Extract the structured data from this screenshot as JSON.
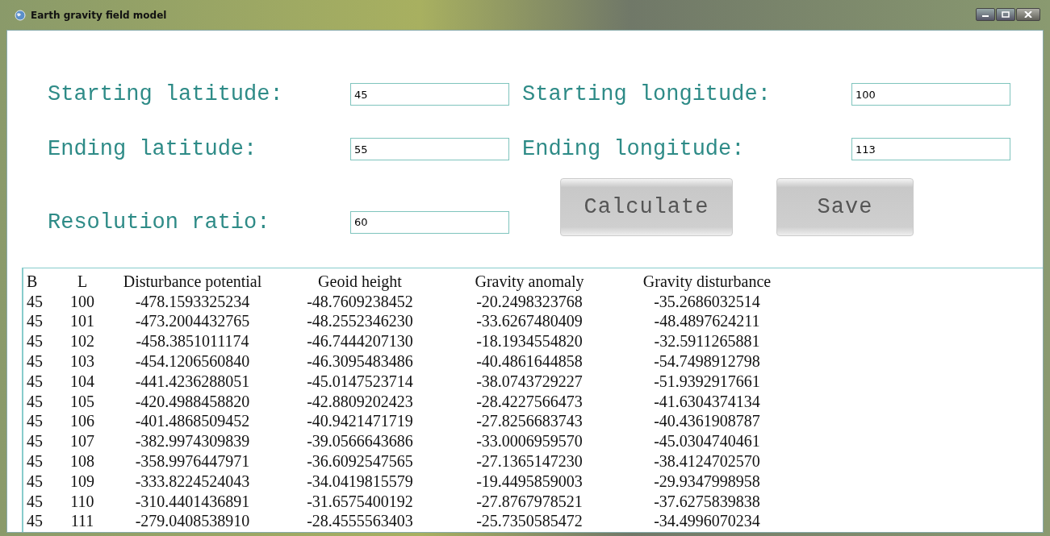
{
  "window": {
    "title": "Earth gravity field model"
  },
  "fields": [
    {
      "label": "Starting latitude:",
      "value": "45"
    },
    {
      "label": "Starting longitude:",
      "value": "100"
    },
    {
      "label": "Ending latitude:",
      "value": "55"
    },
    {
      "label": "Ending longitude:",
      "value": "113"
    },
    {
      "label": "Resolution ratio:",
      "value": "60"
    }
  ],
  "buttons": [
    "Calculate",
    "Save"
  ],
  "table": {
    "columns": [
      "B",
      "L",
      "Disturbance potential",
      "Geoid height",
      "Gravity anomaly",
      "Gravity disturbance"
    ],
    "rows": [
      [
        "45",
        "100",
        "-478.1593325234",
        "-48.7609238452",
        "-20.2498323768",
        "-35.2686032514"
      ],
      [
        "45",
        "101",
        "-473.2004432765",
        "-48.2552346230",
        "-33.6267480409",
        "-48.4897624211"
      ],
      [
        "45",
        "102",
        "-458.3851011174",
        "-46.7444207130",
        "-18.1934554820",
        "-32.5911265881"
      ],
      [
        "45",
        "103",
        "-454.1206560840",
        "-46.3095483486",
        "-40.4861644858",
        "-54.7498912798"
      ],
      [
        "45",
        "104",
        "-441.4236288051",
        "-45.0147523714",
        "-38.0743729227",
        "-51.9392917661"
      ],
      [
        "45",
        "105",
        "-420.4988458820",
        "-42.8809202423",
        "-28.4227566473",
        "-41.6304374134"
      ],
      [
        "45",
        "106",
        "-401.4868509452",
        "-40.9421471719",
        "-27.8256683743",
        "-40.4361908787"
      ],
      [
        "45",
        "107",
        "-382.9974309839",
        "-39.0566643686",
        "-33.0006959570",
        "-45.0304740461"
      ],
      [
        "45",
        "108",
        "-358.9976447971",
        "-36.6092547565",
        "-27.1365147230",
        "-38.4124702570"
      ],
      [
        "45",
        "109",
        "-333.8224524043",
        "-34.0419815579",
        "-19.4495859003",
        "-29.9347998958"
      ],
      [
        "45",
        "110",
        "-310.4401436891",
        "-31.6575400192",
        "-27.8767978521",
        "-37.6275839838"
      ],
      [
        "45",
        "111",
        "-279.0408538910",
        "-28.4555563403",
        "-25.7350585472",
        "-34.4996070234"
      ]
    ]
  }
}
